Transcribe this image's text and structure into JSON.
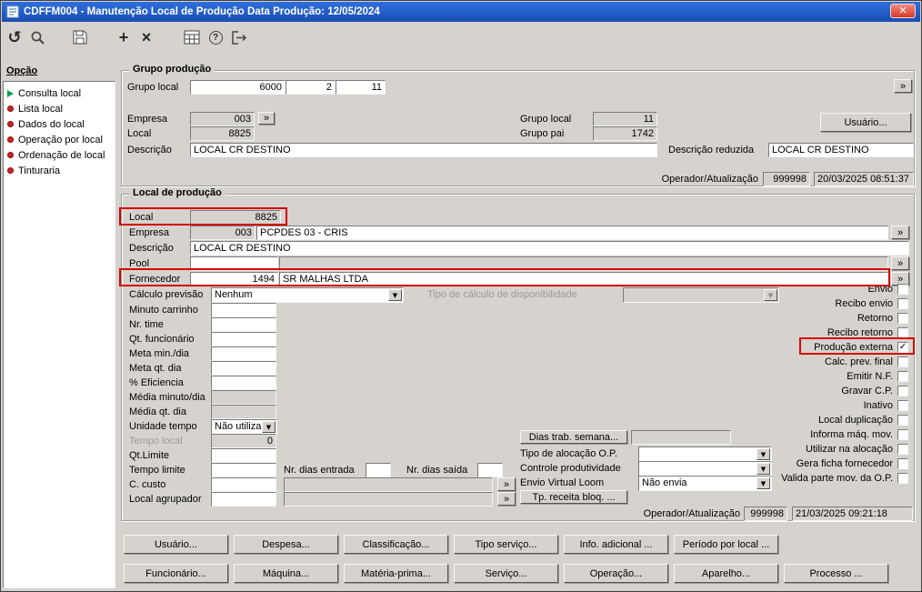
{
  "ui": {
    "close_glyph": "✕",
    "more_glyph": "»",
    "dropdown_glyph": "▼",
    "check_glyph": "✓",
    "undo_glyph": "↺",
    "plus_glyph": "+",
    "delete_glyph": "×",
    "help_glyph": "?"
  },
  "window": {
    "title": "CDFFM004 - Manutenção Local de Produção Data Produção: 12/05/2024"
  },
  "toolbar": {
    "icons": [
      "undo-icon",
      "search-icon",
      "save-icon",
      "add-icon",
      "delete-icon",
      "calendar-icon",
      "help-icon",
      "exit-icon"
    ]
  },
  "sidebar": {
    "title": "Opção",
    "items": [
      {
        "label": "Consulta local",
        "icon": "play-icon"
      },
      {
        "label": "Lista local",
        "icon": "dot-icon"
      },
      {
        "label": "Dados do local",
        "icon": "dot-icon"
      },
      {
        "label": "Operação por local",
        "icon": "dot-icon"
      },
      {
        "label": "Ordenação de local",
        "icon": "dot-icon"
      },
      {
        "label": "Tinturaria",
        "icon": "dot-icon"
      }
    ]
  },
  "grupo_producao": {
    "legend": "Grupo produção",
    "grupo_local_label": "Grupo local",
    "grupo_local_1": "6000",
    "grupo_local_2": "2",
    "grupo_local_3": "11",
    "empresa_label": "Empresa",
    "empresa_value": "003",
    "local_label": "Local",
    "local_value": "8825",
    "grupo_local_right_label": "Grupo local",
    "grupo_local_right_value": "11",
    "grupo_pai_label": "Grupo pai",
    "grupo_pai_value": "1742",
    "usuario_button": "Usuário...",
    "descricao_label": "Descrição",
    "descricao_value": "LOCAL CR DESTINO",
    "descricao_reduzida_label": "Descrição reduzida",
    "descricao_reduzida_value": "LOCAL CR DESTINO",
    "operador_label": "Operador/Atualização",
    "operador_user": "999998",
    "operador_timestamp": "20/03/2025 08:51:37"
  },
  "local_producao": {
    "legend": "Local de produção",
    "local_label": "Local",
    "local_value": "8825",
    "empresa_label": "Empresa",
    "empresa_value": "003",
    "empresa_desc": "PCPDES 03 - CRIS",
    "descricao_label": "Descrição",
    "descricao_value": "LOCAL CR DESTINO",
    "pool_label": "Pool",
    "fornecedor_label": "Fornecedor",
    "fornecedor_value": "1494",
    "fornecedor_desc": "SR MALHAS LTDA",
    "calculo_previsao_label": "Cálculo previsão",
    "calculo_previsao_value": "Nenhum",
    "tipo_calculo_label": "Tipo de cálculo de disponibilidade",
    "minuto_carrinho_label": "Minuto carrinho",
    "nr_time_label": "Nr. time",
    "qt_funcionario_label": "Qt. funcionário",
    "meta_min_dia_label": "Meta min./dia",
    "meta_qt_dia_label": "Meta qt. dia",
    "eficiencia_label": "% Eficiencia",
    "media_minuto_label": "Média minuto/dia",
    "media_qt_label": "Média qt. dia",
    "unidade_tempo_label": "Unidade tempo",
    "unidade_tempo_value": "Não utiliza",
    "tempo_local_label": "Tempo local",
    "tempo_local_value": "0",
    "qt_limite_label": "Qt.Limite",
    "tempo_limite_label": "Tempo limite",
    "nr_dias_entrada_label": "Nr. dias entrada",
    "nr_dias_saida_label": "Nr. dias saída",
    "c_custo_label": "C. custo",
    "local_agrupador_label": "Local agrupador",
    "dias_trab_button": "Dias trab. semana...",
    "tipo_alocacao_label": "Tipo de alocação O.P.",
    "controle_produtividade_label": "Controle produtividade",
    "envio_virtual_loom_label": "Envio Virtual Loom",
    "envio_virtual_loom_value": "Não envia",
    "tp_receita_button": "Tp. receita bloq. ...",
    "operador_label": "Operador/Atualização",
    "operador_user": "999998",
    "operador_timestamp": "21/03/2025 09:21:18",
    "checkboxes": [
      {
        "label": "Envio",
        "checked": false
      },
      {
        "label": "Recibo envio",
        "checked": false
      },
      {
        "label": "Retorno",
        "checked": false
      },
      {
        "label": "Recibo retorno",
        "checked": false
      },
      {
        "label": "Produção externa",
        "checked": true
      },
      {
        "label": "Calc. prev. final",
        "checked": false
      },
      {
        "label": "Emitir N.F.",
        "checked": false
      },
      {
        "label": "Gravar C.P.",
        "checked": false
      },
      {
        "label": "Inativo",
        "checked": false
      },
      {
        "label": "Local duplicação",
        "checked": false
      },
      {
        "label": "Informa máq. mov.",
        "checked": false
      },
      {
        "label": "Utilizar na alocação",
        "checked": false
      },
      {
        "label": "Gera ficha fornecedor",
        "checked": false
      },
      {
        "label": "Valida parte mov. da O.P.",
        "checked": false
      }
    ]
  },
  "bottom_buttons_row1": [
    "Usuário...",
    "Despesa...",
    "Classificação...",
    "Tipo serviço...",
    "Info. adicional ...",
    "Período por local ..."
  ],
  "bottom_buttons_row2": [
    "Funcionário...",
    "Máquina...",
    "Matéria-prima...",
    "Serviço...",
    "Operação...",
    "Aparelho...",
    "Processo ..."
  ]
}
